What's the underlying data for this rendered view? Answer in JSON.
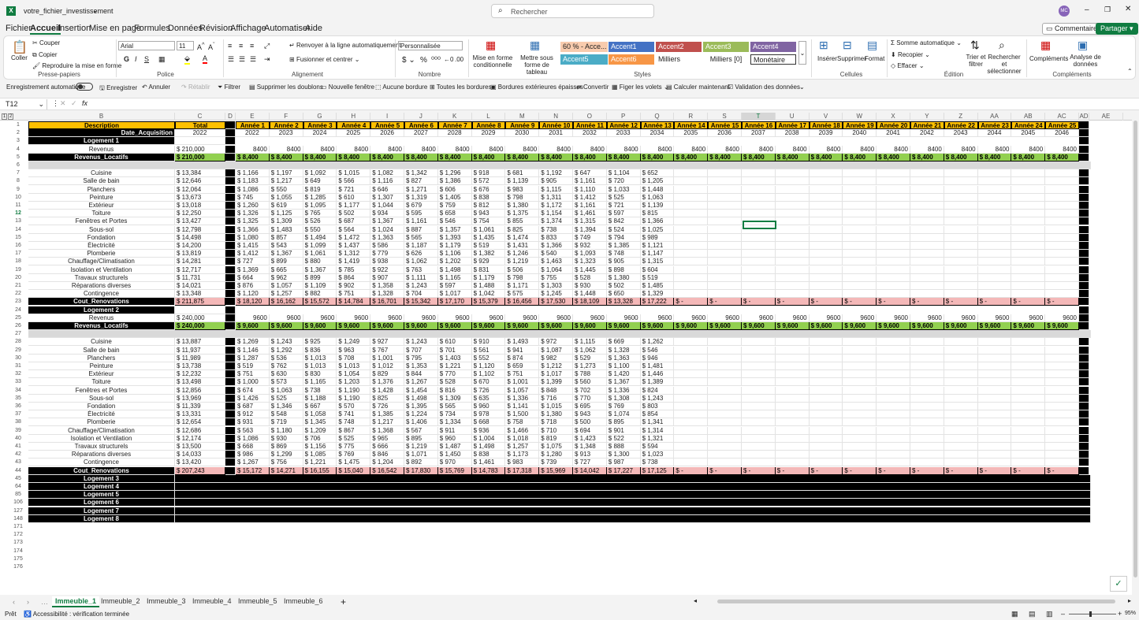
{
  "title_bar": {
    "file_name": "votre_fichier_investissement",
    "user_initials": "MC"
  },
  "search": {
    "placeholder": "Rechercher"
  },
  "menu": [
    "Fichier",
    "Accueil",
    "Insertion",
    "Mise en page",
    "Formules",
    "Données",
    "Révision",
    "Affichage",
    "Automatiser",
    "Aide"
  ],
  "comments_label": "Commentaires",
  "share_label": "Partager",
  "ribbon": {
    "coller": "Coller",
    "couper": "Couper",
    "copier": "Copier",
    "reproduire": "Reproduire la mise en forme",
    "presse_papiers": "Presse-papiers",
    "font": "Arial",
    "size": "11",
    "police": "Police",
    "renvoyer": "Renvoyer à la ligne automatiquement",
    "fusionner": "Fusionner et centrer",
    "alignement": "Alignement",
    "format_value": "Personnalisée",
    "nombre": "Nombre",
    "mise_forme_cond": "Mise en forme conditionnelle",
    "mettre_tableau": "Mettre sous forme de tableau",
    "styles": [
      "60 % - Acce...",
      "Accent1",
      "Accent2",
      "Accent3",
      "Accent4",
      "Accent5",
      "Accent6",
      "Milliers",
      "Milliers [0]",
      "Monétaire"
    ],
    "styles_label": "Styles",
    "inserer": "Insérer",
    "supprimer": "Supprimer",
    "format": "Format",
    "cellules": "Cellules",
    "somme": "Somme automatique",
    "recopier": "Recopier",
    "effacer": "Effacer",
    "trier": "Trier et filtrer",
    "rechercher_sel": "Rechercher et sélectionner",
    "edition": "Édition",
    "complements": "Compléments",
    "analyse": "Analyse de données",
    "complements_group": "Compléments"
  },
  "qat": [
    "Enregistrement automatique",
    "Enregistrer",
    "Annuler",
    "Rétablir",
    "Filtrer",
    "Supprimer les doublons",
    "Nouvelle fenêtre",
    "Aucune bordure",
    "Toutes les bordures",
    "Bordures extérieures épaisses",
    "Convertir",
    "Figer les volets",
    "Calculer maintenant",
    "Validation des données"
  ],
  "name_box": "T12",
  "fx_label": "fx",
  "columns": [
    "B",
    "C",
    "D",
    "E",
    "F",
    "G",
    "H",
    "I",
    "J",
    "K",
    "L",
    "M",
    "N",
    "O",
    "P",
    "Q",
    "R",
    "S",
    "T",
    "U",
    "V",
    "W",
    "X",
    "Y",
    "Z",
    "AA",
    "AB",
    "AC",
    "AD",
    "AE"
  ],
  "year_headers": [
    "Année 1",
    "Année 2",
    "Année 3",
    "Année 4",
    "Année 5",
    "Année 6",
    "Année 7",
    "Année 8",
    "Année 9",
    "Année 10",
    "Année 11",
    "Année 12",
    "Année 13",
    "Année 14",
    "Année 15",
    "Année 16",
    "Année 17",
    "Année 18",
    "Année 19",
    "Année 20",
    "Année 21",
    "Année 22",
    "Année 23",
    "Année 24",
    "Année 25"
  ],
  "years": [
    "2022",
    "2023",
    "2024",
    "2025",
    "2026",
    "2027",
    "2028",
    "2029",
    "2030",
    "2031",
    "2032",
    "2033",
    "2034",
    "2035",
    "2036",
    "2037",
    "2038",
    "2039",
    "2040",
    "2041",
    "2042",
    "2043",
    "2044",
    "2045",
    "2046"
  ],
  "header": {
    "description": "Description",
    "total": "Total",
    "date_acq": "Date_Acquisition",
    "date_val": "2022"
  },
  "logement1": {
    "label": "Logement 1",
    "revenus": "Revenus",
    "rev_total": "210,000",
    "rev_year": "8400",
    "rev_loc_label": "Revenus_Locatifs",
    "rev_loc_total": "210,000",
    "rev_loc_year": "8,400",
    "items": [
      {
        "n": "Cuisine",
        "t": "13,384",
        "v": [
          "1,166",
          "1,197",
          "1,092",
          "1,015",
          "1,082",
          "1,342",
          "1,296",
          "918",
          "681",
          "1,192",
          "647",
          "1,104",
          "652"
        ]
      },
      {
        "n": "Salle de bain",
        "t": "12,646",
        "v": [
          "1,183",
          "1,217",
          "649",
          "566",
          "1,116",
          "827",
          "1,386",
          "572",
          "1,139",
          "905",
          "1,161",
          "720",
          "1,205"
        ]
      },
      {
        "n": "Planchers",
        "t": "12,064",
        "v": [
          "1,086",
          "550",
          "819",
          "721",
          "646",
          "1,271",
          "606",
          "676",
          "983",
          "1,115",
          "1,110",
          "1,033",
          "1,448"
        ]
      },
      {
        "n": "Peinture",
        "t": "13,673",
        "v": [
          "745",
          "1,055",
          "1,285",
          "610",
          "1,307",
          "1,319",
          "1,405",
          "838",
          "798",
          "1,311",
          "1,412",
          "525",
          "1,063"
        ]
      },
      {
        "n": "Extérieur",
        "t": "13,018",
        "v": [
          "1,260",
          "619",
          "1,095",
          "1,177",
          "1,044",
          "679",
          "759",
          "812",
          "1,380",
          "1,172",
          "1,161",
          "721",
          "1,139"
        ]
      },
      {
        "n": "Toiture",
        "t": "12,250",
        "v": [
          "1,326",
          "1,125",
          "765",
          "502",
          "934",
          "595",
          "658",
          "943",
          "1,375",
          "1,154",
          "1,461",
          "597",
          "815"
        ]
      },
      {
        "n": "Fenêtres et Portes",
        "t": "13,427",
        "v": [
          "1,325",
          "1,309",
          "526",
          "687",
          "1,367",
          "1,161",
          "546",
          "754",
          "855",
          "1,374",
          "1,315",
          "842",
          "1,366"
        ]
      },
      {
        "n": "Sous-sol",
        "t": "12,798",
        "v": [
          "1,366",
          "1,483",
          "550",
          "564",
          "1,024",
          "887",
          "1,357",
          "1,061",
          "825",
          "738",
          "1,394",
          "524",
          "1,025"
        ]
      },
      {
        "n": "Fondation",
        "t": "14,498",
        "v": [
          "1,080",
          "857",
          "1,494",
          "1,472",
          "1,363",
          "565",
          "1,393",
          "1,435",
          "1,474",
          "833",
          "749",
          "794",
          "989"
        ]
      },
      {
        "n": "Électricité",
        "t": "14,200",
        "v": [
          "1,415",
          "543",
          "1,099",
          "1,437",
          "586",
          "1,187",
          "1,179",
          "519",
          "1,431",
          "1,366",
          "932",
          "1,385",
          "1,121"
        ]
      },
      {
        "n": "Plomberie",
        "t": "13,819",
        "v": [
          "1,412",
          "1,367",
          "1,061",
          "1,312",
          "779",
          "626",
          "1,106",
          "1,382",
          "1,246",
          "540",
          "1,093",
          "748",
          "1,147"
        ]
      },
      {
        "n": "Chauffage/Climatisation",
        "t": "14,281",
        "v": [
          "727",
          "899",
          "880",
          "1,419",
          "938",
          "1,062",
          "1,202",
          "929",
          "1,219",
          "1,463",
          "1,323",
          "905",
          "1,315"
        ]
      },
      {
        "n": "Isolation et Ventilation",
        "t": "12,717",
        "v": [
          "1,369",
          "665",
          "1,367",
          "785",
          "922",
          "763",
          "1,498",
          "831",
          "506",
          "1,064",
          "1,445",
          "898",
          "604"
        ]
      },
      {
        "n": "Travaux structurels",
        "t": "11,731",
        "v": [
          "664",
          "962",
          "899",
          "864",
          "907",
          "1,111",
          "1,165",
          "1,179",
          "798",
          "755",
          "528",
          "1,380",
          "519"
        ]
      },
      {
        "n": "Réparations diverses",
        "t": "14,021",
        "v": [
          "876",
          "1,057",
          "1,109",
          "902",
          "1,358",
          "1,243",
          "597",
          "1,488",
          "1,171",
          "1,303",
          "930",
          "502",
          "1,485"
        ]
      },
      {
        "n": "Contingence",
        "t": "13,348",
        "v": [
          "1,120",
          "1,257",
          "882",
          "751",
          "1,328",
          "704",
          "1,017",
          "1,042",
          "575",
          "1,245",
          "1,448",
          "650",
          "1,329"
        ]
      }
    ],
    "cout_label": "Cout_Renovations",
    "cout_total": "211,875",
    "cout": [
      "18,120",
      "16,162",
      "15,572",
      "14,784",
      "16,701",
      "15,342",
      "17,170",
      "15,379",
      "16,456",
      "17,530",
      "18,109",
      "13,328",
      "17,222"
    ]
  },
  "logement2": {
    "label": "Logement 2",
    "revenus": "Revenus",
    "rev_total": "240,000",
    "rev_year": "9600",
    "rev_loc_label": "Revenus_Locatifs",
    "rev_loc_total": "240,000",
    "rev_loc_year": "9,600",
    "items": [
      {
        "n": "Cuisine",
        "t": "13,887",
        "v": [
          "1,269",
          "1,243",
          "925",
          "1,249",
          "927",
          "1,243",
          "610",
          "910",
          "1,493",
          "972",
          "1,115",
          "669",
          "1,262"
        ]
      },
      {
        "n": "Salle de bain",
        "t": "11,937",
        "v": [
          "1,146",
          "1,292",
          "836",
          "963",
          "767",
          "707",
          "701",
          "561",
          "941",
          "1,087",
          "1,062",
          "1,328",
          "546"
        ]
      },
      {
        "n": "Planchers",
        "t": "11,989",
        "v": [
          "1,287",
          "536",
          "1,013",
          "708",
          "1,001",
          "795",
          "1,403",
          "552",
          "874",
          "982",
          "529",
          "1,363",
          "946"
        ]
      },
      {
        "n": "Peinture",
        "t": "13,738",
        "v": [
          "519",
          "762",
          "1,013",
          "1,013",
          "1,012",
          "1,353",
          "1,221",
          "1,120",
          "659",
          "1,212",
          "1,273",
          "1,100",
          "1,481"
        ]
      },
      {
        "n": "Extérieur",
        "t": "12,232",
        "v": [
          "751",
          "630",
          "830",
          "1,054",
          "829",
          "844",
          "770",
          "1,102",
          "751",
          "1,017",
          "788",
          "1,420",
          "1,446"
        ]
      },
      {
        "n": "Toiture",
        "t": "13,498",
        "v": [
          "1,000",
          "573",
          "1,165",
          "1,203",
          "1,376",
          "1,267",
          "528",
          "670",
          "1,001",
          "1,399",
          "560",
          "1,367",
          "1,389"
        ]
      },
      {
        "n": "Fenêtres et Portes",
        "t": "12,856",
        "v": [
          "674",
          "1,063",
          "738",
          "1,190",
          "1,428",
          "1,454",
          "816",
          "726",
          "1,057",
          "848",
          "702",
          "1,336",
          "824"
        ]
      },
      {
        "n": "Sous-sol",
        "t": "13,969",
        "v": [
          "1,426",
          "525",
          "1,188",
          "1,190",
          "825",
          "1,498",
          "1,309",
          "635",
          "1,336",
          "716",
          "770",
          "1,308",
          "1,243"
        ]
      },
      {
        "n": "Fondation",
        "t": "11,339",
        "v": [
          "687",
          "1,346",
          "667",
          "570",
          "726",
          "1,395",
          "565",
          "960",
          "1,141",
          "1,015",
          "695",
          "769",
          "803"
        ]
      },
      {
        "n": "Électricité",
        "t": "13,331",
        "v": [
          "912",
          "548",
          "1,058",
          "741",
          "1,385",
          "1,224",
          "734",
          "978",
          "1,500",
          "1,380",
          "943",
          "1,074",
          "854"
        ]
      },
      {
        "n": "Plomberie",
        "t": "12,654",
        "v": [
          "931",
          "719",
          "1,345",
          "748",
          "1,217",
          "1,406",
          "1,334",
          "668",
          "758",
          "718",
          "500",
          "895",
          "1,341"
        ]
      },
      {
        "n": "Chauffage/Climatisation",
        "t": "12,686",
        "v": [
          "563",
          "1,180",
          "1,209",
          "867",
          "1,368",
          "567",
          "911",
          "936",
          "1,466",
          "710",
          "694",
          "901",
          "1,314"
        ]
      },
      {
        "n": "Isolation et Ventilation",
        "t": "12,174",
        "v": [
          "1,086",
          "930",
          "706",
          "525",
          "965",
          "895",
          "960",
          "1,004",
          "1,018",
          "819",
          "1,423",
          "522",
          "1,321"
        ]
      },
      {
        "n": "Travaux structurels",
        "t": "13,500",
        "v": [
          "668",
          "869",
          "1,156",
          "775",
          "666",
          "1,219",
          "1,487",
          "1,498",
          "1,257",
          "1,075",
          "1,348",
          "888",
          "594"
        ]
      },
      {
        "n": "Réparations diverses",
        "t": "14,033",
        "v": [
          "986",
          "1,299",
          "1,085",
          "769",
          "846",
          "1,071",
          "1,450",
          "838",
          "1,173",
          "1,280",
          "913",
          "1,300",
          "1,023"
        ]
      },
      {
        "n": "Contingence",
        "t": "13,420",
        "v": [
          "1,267",
          "756",
          "1,221",
          "1,475",
          "1,204",
          "892",
          "970",
          "1,461",
          "983",
          "739",
          "727",
          "987",
          "738"
        ]
      }
    ],
    "cout_label": "Cout_Renovations",
    "cout_total": "207,243",
    "cout": [
      "15,172",
      "14,271",
      "16,155",
      "15,040",
      "16,542",
      "17,830",
      "15,769",
      "14,783",
      "17,318",
      "15,969",
      "14,042",
      "17,227",
      "17,125"
    ]
  },
  "collapsed": [
    "Logement 3",
    "Logement 4",
    "Logement 5",
    "Logement 6",
    "Logement 7",
    "Logement 8"
  ],
  "collapsed_rows": [
    "45",
    "64",
    "85",
    "106",
    "127",
    "148"
  ],
  "visible_rownums_collapsed": [
    "45",
    "64",
    "85",
    "106",
    "127",
    "148"
  ],
  "empty_rows": [
    "171",
    "172",
    "173",
    "174",
    "175",
    "176"
  ],
  "dash": "-",
  "dollar": "$",
  "sheets": [
    "Immeuble_1",
    "Immeuble_2",
    "Immeuble_3",
    "Immeuble_4",
    "Immeuble_5",
    "Immeuble_6"
  ],
  "status": {
    "ready": "Prêt",
    "accessibility": "Accessibilité : vérification terminée",
    "zoom": "95%"
  },
  "colors": {
    "accent": "#107c41",
    "gold": "#ffc000",
    "green": "#92d050",
    "pink": "#f4b8b8"
  }
}
